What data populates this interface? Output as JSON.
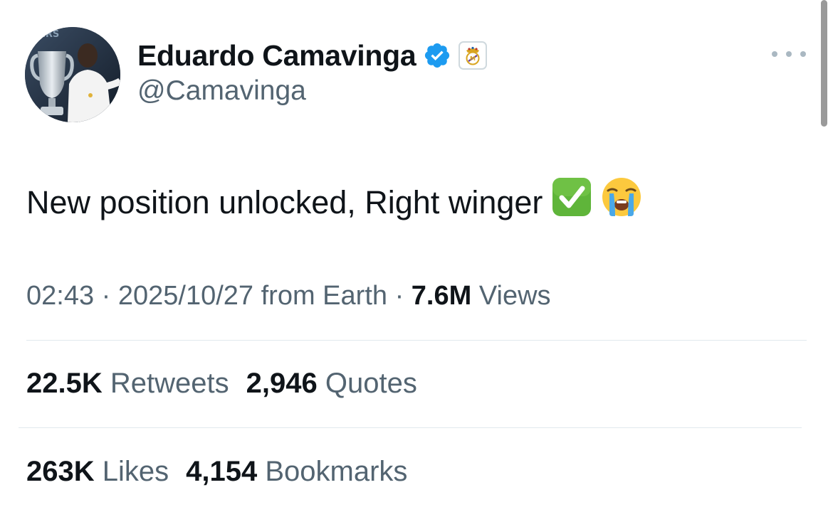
{
  "author": {
    "display_name": "Eduardo Camavinga",
    "handle": "@Camavinga",
    "avatar_icon": "profile-photo-with-trophy",
    "verified_icon": "verified-badge-icon",
    "affiliate_icon": "real-madrid-crest-icon",
    "avatar_text": "ERS"
  },
  "tweet": {
    "text": "New position unlocked, Right winger",
    "emojis": [
      "check-mark-button-emoji",
      "loudly-crying-face-emoji"
    ]
  },
  "meta": {
    "time": "02:43",
    "sep1": "·",
    "date": "2025/10/27",
    "location": "from Earth",
    "sep2": "·",
    "views_count": "7.6M",
    "views_label": "Views"
  },
  "stats_row1": [
    {
      "count": "22.5K",
      "label": "Retweets"
    },
    {
      "count": "2,946",
      "label": "Quotes"
    }
  ],
  "stats_row2": [
    {
      "count": "263K",
      "label": "Likes"
    },
    {
      "count": "4,154",
      "label": "Bookmarks"
    }
  ],
  "colors": {
    "verified_blue": "#1d9bf0",
    "secondary_text": "#536471",
    "primary_text": "#0f1419",
    "divider": "#e1e8ed"
  }
}
